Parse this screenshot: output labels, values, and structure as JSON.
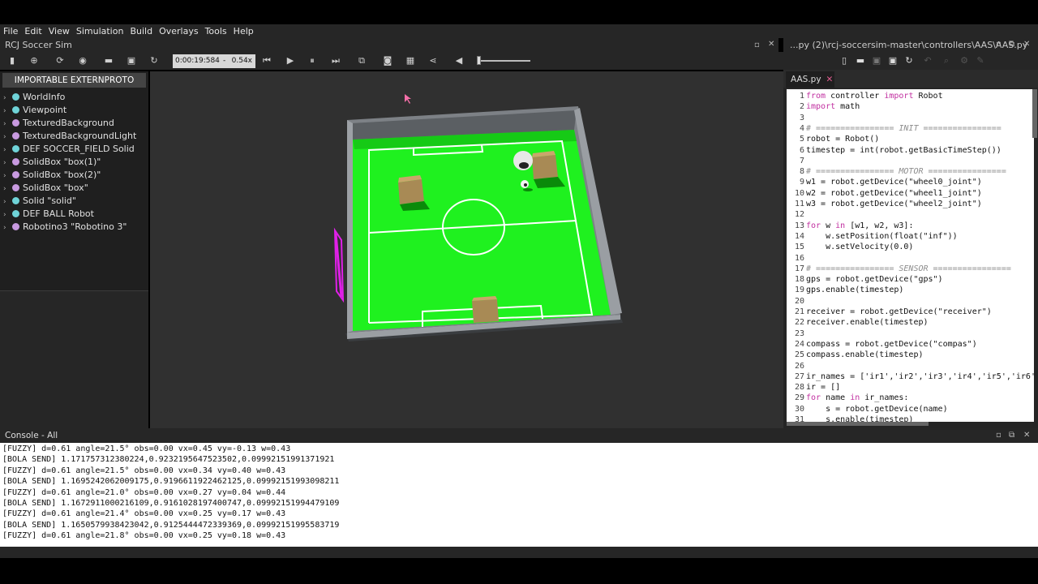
{
  "menu": [
    "File",
    "Edit",
    "View",
    "Simulation",
    "Build",
    "Overlays",
    "Tools",
    "Help"
  ],
  "app_title": "RCJ Soccer Sim",
  "editor_title": "...py (2)\\rcj-soccersim-master\\controllers\\AAS\\AAS.py",
  "toolbar": {
    "time": "0:00:19:584",
    "separator": "-",
    "speed": "0.54x"
  },
  "scene_tree": {
    "header": "IMPORTABLE EXTERNPROTO",
    "items": [
      {
        "label": "WorldInfo",
        "color": "#6fd3d8"
      },
      {
        "label": "Viewpoint",
        "color": "#6fd3d8"
      },
      {
        "label": "TexturedBackground",
        "color": "#c89ae0"
      },
      {
        "label": "TexturedBackgroundLight",
        "color": "#c89ae0"
      },
      {
        "label": "DEF SOCCER_FIELD Solid",
        "color": "#6fd3d8"
      },
      {
        "label": "SolidBox \"box(1)\"",
        "color": "#c89ae0"
      },
      {
        "label": "SolidBox \"box(2)\"",
        "color": "#c89ae0"
      },
      {
        "label": "SolidBox \"box\"",
        "color": "#c89ae0"
      },
      {
        "label": "Solid \"solid\"",
        "color": "#6fd3d8"
      },
      {
        "label": "DEF BALL Robot",
        "color": "#6fd3d8"
      },
      {
        "label": "Robotino3 \"Robotino 3\"",
        "color": "#c89ae0"
      }
    ]
  },
  "editor": {
    "tab": "AAS.py",
    "lines": [
      {
        "n": "1",
        "parts": [
          [
            "kw",
            "from"
          ],
          [
            "",
            " controller "
          ],
          [
            "kw",
            "import"
          ],
          [
            "",
            " Robot"
          ]
        ]
      },
      {
        "n": "2",
        "parts": [
          [
            "kw",
            "import"
          ],
          [
            "",
            " math"
          ]
        ]
      },
      {
        "n": "3",
        "parts": []
      },
      {
        "n": "4",
        "parts": [
          [
            "cm",
            "# ================ INIT ================"
          ]
        ]
      },
      {
        "n": "5",
        "parts": [
          [
            "",
            "robot = Robot()"
          ]
        ]
      },
      {
        "n": "6",
        "parts": [
          [
            "",
            "timestep = int(robot.getBasicTimeStep())"
          ]
        ]
      },
      {
        "n": "7",
        "parts": []
      },
      {
        "n": "8",
        "parts": [
          [
            "cm",
            "# ================ MOTOR ================"
          ]
        ]
      },
      {
        "n": "9",
        "parts": [
          [
            "",
            "w1 = robot.getDevice(\"wheel0_joint\")"
          ]
        ]
      },
      {
        "n": "10",
        "parts": [
          [
            "",
            "w2 = robot.getDevice(\"wheel1_joint\")"
          ]
        ]
      },
      {
        "n": "11",
        "parts": [
          [
            "",
            "w3 = robot.getDevice(\"wheel2_joint\")"
          ]
        ]
      },
      {
        "n": "12",
        "parts": []
      },
      {
        "n": "13",
        "parts": [
          [
            "kw",
            "for"
          ],
          [
            "",
            " w "
          ],
          [
            "kw",
            "in"
          ],
          [
            "",
            " [w1, w2, w3]:"
          ]
        ]
      },
      {
        "n": "14",
        "parts": [
          [
            "",
            "    w.setPosition(float(\"inf\"))"
          ]
        ]
      },
      {
        "n": "15",
        "parts": [
          [
            "",
            "    w.setVelocity(0.0)"
          ]
        ]
      },
      {
        "n": "16",
        "parts": []
      },
      {
        "n": "17",
        "parts": [
          [
            "cm",
            "# ================ SENSOR ================"
          ]
        ]
      },
      {
        "n": "18",
        "parts": [
          [
            "",
            "gps = robot.getDevice(\"gps\")"
          ]
        ]
      },
      {
        "n": "19",
        "parts": [
          [
            "",
            "gps.enable(timestep)"
          ]
        ]
      },
      {
        "n": "20",
        "parts": []
      },
      {
        "n": "21",
        "parts": [
          [
            "",
            "receiver = robot.getDevice(\"receiver\")"
          ]
        ]
      },
      {
        "n": "22",
        "parts": [
          [
            "",
            "receiver.enable(timestep)"
          ]
        ]
      },
      {
        "n": "23",
        "parts": []
      },
      {
        "n": "24",
        "parts": [
          [
            "",
            "compass = robot.getDevice(\"compas\")"
          ]
        ]
      },
      {
        "n": "25",
        "parts": [
          [
            "",
            "compass.enable(timestep)"
          ]
        ]
      },
      {
        "n": "26",
        "parts": []
      },
      {
        "n": "27",
        "parts": [
          [
            "",
            "ir_names = ['ir1','ir2','ir3','ir4','ir5','ir6'"
          ]
        ]
      },
      {
        "n": "28",
        "parts": [
          [
            "",
            "ir = []"
          ]
        ]
      },
      {
        "n": "29",
        "parts": [
          [
            "kw",
            "for"
          ],
          [
            "",
            " name "
          ],
          [
            "kw",
            "in"
          ],
          [
            "",
            " ir_names:"
          ]
        ]
      },
      {
        "n": "30",
        "parts": [
          [
            "",
            "    s = robot.getDevice(name)"
          ]
        ]
      },
      {
        "n": "31",
        "parts": [
          [
            "",
            "    s.enable(timestep)"
          ]
        ]
      }
    ]
  },
  "console": {
    "title": "Console - All",
    "lines": [
      "[FUZZY] d=0.61 angle=21.5° obs=0.00 vx=0.45 vy=-0.13 w=0.43",
      "[BOLA SEND] 1.171757312380224,0.9232195647523502,0.09992151991371921",
      "[FUZZY] d=0.61 angle=21.5° obs=0.00 vx=0.34 vy=0.40 w=0.43",
      "[BOLA SEND] 1.1695242062009175,0.9196611922462125,0.09992151993098211",
      "[FUZZY] d=0.61 angle=21.0° obs=0.00 vx=0.27 vy=0.04 w=0.44",
      "[BOLA SEND] 1.1672911000216109,0.9161028197400747,0.09992151994479109",
      "[FUZZY] d=0.61 angle=21.4° obs=0.00 vx=0.25 vy=0.17 w=0.43",
      "[BOLA SEND] 1.1650579938423042,0.9125444472339369,0.09992151995583719",
      "[FUZZY] d=0.61 angle=21.8° obs=0.00 vx=0.25 vy=0.18 w=0.43"
    ]
  },
  "icons": {
    "toolbar": [
      "sidebar-toggle-icon",
      "add-node-icon",
      "reload-icon",
      "eye-icon",
      "open-folder-icon",
      "save-icon",
      "revert-icon",
      "step-back-icon",
      "play-icon",
      "pause-icon",
      "fast-forward-icon",
      "reset-view-icon",
      "camera-icon",
      "record-icon",
      "share-icon",
      "sound-icon"
    ],
    "editor_toolbar": [
      "new-file-icon",
      "open-file-icon",
      "save-as-icon",
      "save-icon",
      "revert-icon"
    ]
  },
  "colors": {
    "field_green": "#1ff11f",
    "wall_gray": "#8b8f94",
    "selection_magenta": "#e020e8",
    "keyword": "#c12fa0",
    "comment": "#8d8d8d"
  }
}
